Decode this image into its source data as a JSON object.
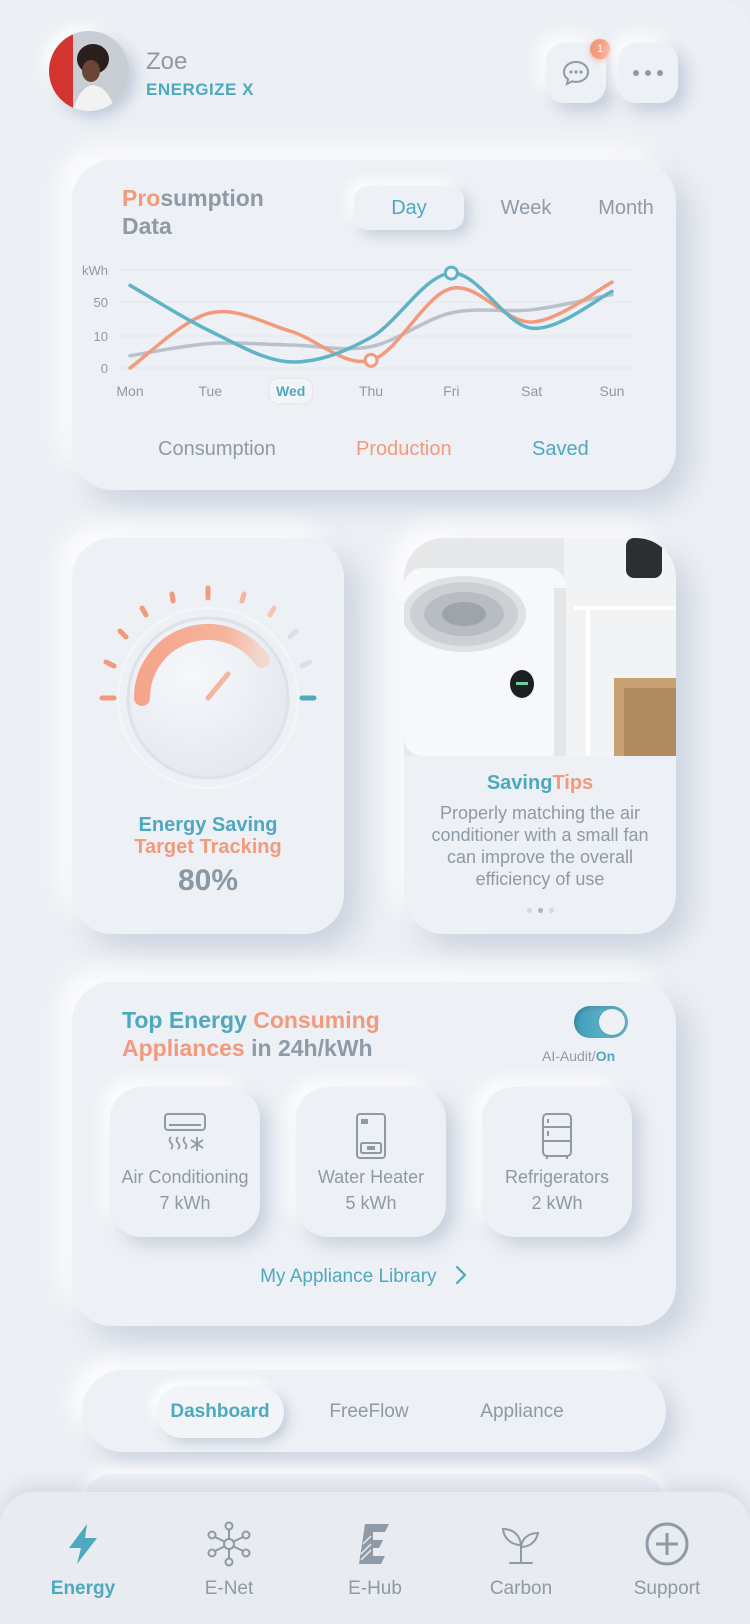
{
  "user": {
    "name": "Zoe",
    "brand": "ENERGIZE X"
  },
  "header": {
    "notification_count": "1"
  },
  "prosumption": {
    "title_highlight": "Pro",
    "title_rest_line1": "sumption",
    "title_line2": "Data",
    "tabs": [
      {
        "label": "Day",
        "active": true
      },
      {
        "label": "Week",
        "active": false
      },
      {
        "label": "Month",
        "active": false
      }
    ],
    "legend": {
      "consumption": "Consumption",
      "production": "Production",
      "saved": "Saved"
    },
    "chart_data": {
      "type": "line",
      "ylabel": "kWh",
      "y_tick_labels": [
        "0",
        "10",
        "50",
        "kWh"
      ],
      "categories": [
        "Mon",
        "Tue",
        "Wed",
        "Thu",
        "Fri",
        "Sat",
        "Sun"
      ],
      "highlighted_category": "Wed",
      "series": [
        {
          "name": "Consumption",
          "color": "#b9c2cc",
          "values": [
            0.4,
            0.8,
            0.75,
            0.7,
            1.8,
            1.9,
            2.4
          ]
        },
        {
          "name": "Production",
          "color": "#f39a7c",
          "values": [
            0.0,
            1.8,
            1.2,
            0.25,
            2.6,
            1.5,
            2.8
          ]
        },
        {
          "name": "Saved",
          "color": "#5fb3c7",
          "values": [
            2.7,
            1.2,
            0.2,
            1.0,
            3.1,
            1.3,
            2.5
          ]
        }
      ]
    }
  },
  "gauge": {
    "title_line1": "Energy Saving",
    "title_line2": "Target Tracking",
    "value": "80%",
    "progress_fraction": 0.8
  },
  "tips": {
    "title_saving": "Saving",
    "title_tips": "Tips",
    "text": "Properly matching the air conditioner with a small fan can improve the overall efficiency of use"
  },
  "appliances": {
    "title_part1": "Top Energy",
    "title_part2": "Consuming",
    "title_part3": "Appliances",
    "title_part4": "in 24h/kWh",
    "ai_audit_label": "AI-Audit/",
    "ai_audit_state": "On",
    "items": [
      {
        "name": "Air Conditioning",
        "value": "7 kWh",
        "icon": "air-conditioner-icon"
      },
      {
        "name": "Water Heater",
        "value": "5 kWh",
        "icon": "water-heater-icon"
      },
      {
        "name": "Refrigerators",
        "value": "2 kWh",
        "icon": "refrigerator-icon"
      }
    ],
    "library_link": "My Appliance Library"
  },
  "view_switcher": [
    {
      "label": "Dashboard",
      "active": true
    },
    {
      "label": "FreeFlow",
      "active": false
    },
    {
      "label": "Appliance",
      "active": false
    }
  ],
  "bottom_nav": [
    {
      "label": "Energy",
      "icon": "lightning-icon",
      "active": true
    },
    {
      "label": "E-Net",
      "icon": "network-icon",
      "active": false
    },
    {
      "label": "E-Hub",
      "icon": "hub-icon",
      "active": false
    },
    {
      "label": "Carbon",
      "icon": "sprout-icon",
      "active": false
    },
    {
      "label": "Support",
      "icon": "plus-circle-icon",
      "active": false
    }
  ],
  "colors": {
    "teal": "#4ea9bf",
    "coral": "#f39a7c",
    "background": "#eceff4"
  }
}
